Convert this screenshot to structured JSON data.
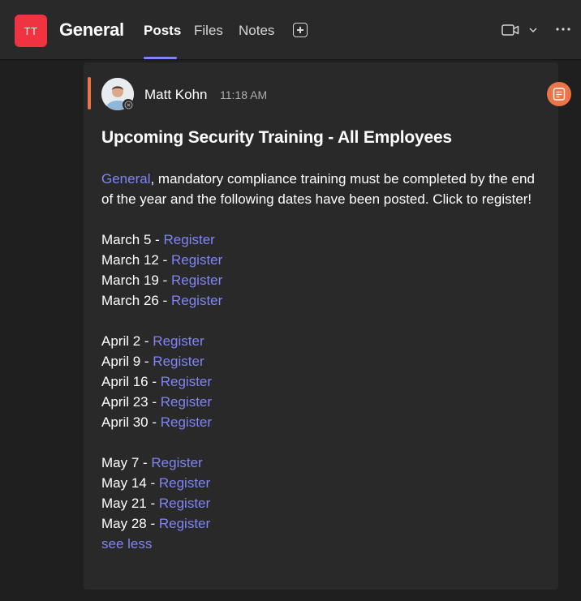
{
  "header": {
    "team_initials": "TT",
    "channel_name": "General",
    "tabs": [
      {
        "label": "Posts",
        "active": true
      },
      {
        "label": "Files",
        "active": false
      },
      {
        "label": "Notes",
        "active": false
      }
    ],
    "icons": [
      "add-tab-icon",
      "video-icon",
      "chevron-down-icon",
      "more-options-icon"
    ],
    "accent_color": "#7f85f5"
  },
  "post": {
    "author": "Matt Kohn",
    "time": "11:18 AM",
    "subject": "Upcoming Security Training - All Employees",
    "mention": "General",
    "intro": ", mandatory compliance training must be completed by the end of the year and the following dates have been posted. Click to register!",
    "separator": " - ",
    "link_label": "Register",
    "groups": [
      [
        "March 5",
        "March 12",
        "March 19",
        "March 26"
      ],
      [
        "April 2",
        "April 9",
        "April 16",
        "April 23",
        "April 30"
      ],
      [
        "May 7",
        "May 14",
        "May 21",
        "May 28"
      ]
    ],
    "see_less": "see less",
    "accent_color": "#e97548",
    "link_color": "#7f85f5"
  }
}
